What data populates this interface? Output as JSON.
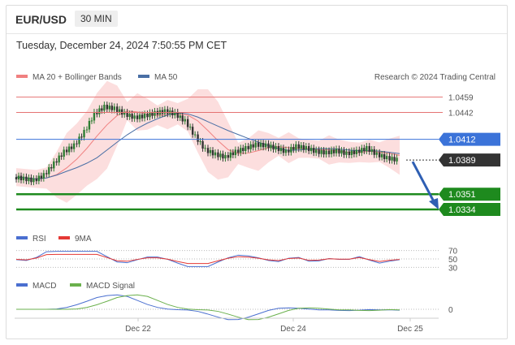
{
  "header": {
    "symbol": "EUR/USD",
    "timeframe": "30 MIN",
    "timestamp": "Tuesday, December 24, 2024 7:50:55 PM CET"
  },
  "chart_data": [
    {
      "type": "candlestick",
      "panel": "price",
      "legend": [
        {
          "name": "MA 20 + Bollinger Bands",
          "color": "#f08080"
        },
        {
          "name": "MA 50",
          "color": "#4a6fa5"
        }
      ],
      "attribution": "Research © 2024 Trading Central",
      "ylim": [
        1.0325,
        1.0465
      ],
      "x_ticks": [
        "Dec 22",
        "Dec 24",
        "Dec 25"
      ],
      "levels": [
        {
          "value": 1.0459,
          "label": "1.0459",
          "color": "#e57373",
          "style": "line-text"
        },
        {
          "value": 1.0442,
          "label": "1.0442",
          "color": "#e57373",
          "style": "line-text"
        },
        {
          "value": 1.0412,
          "label": "1.0412",
          "color": "#3b73d9",
          "style": "line-tag"
        },
        {
          "value": 1.0389,
          "label": "1.0389",
          "color": "#333333",
          "style": "dotted-tag"
        },
        {
          "value": 1.0351,
          "label": "1.0351",
          "color": "#1e8a1e",
          "style": "thick-tag"
        },
        {
          "value": 1.0334,
          "label": "1.0334",
          "color": "#1e8a1e",
          "style": "thick-tag"
        }
      ],
      "current_price": 1.0389,
      "forecast_arrow": {
        "from": 1.0389,
        "to": 1.0334
      },
      "approx_close_path": [
        1.037,
        1.0368,
        1.0366,
        1.0372,
        1.0385,
        1.0398,
        1.0405,
        1.042,
        1.044,
        1.0448,
        1.0446,
        1.044,
        1.0436,
        1.0438,
        1.0441,
        1.0443,
        1.044,
        1.0432,
        1.0415,
        1.04,
        1.0395,
        1.0392,
        1.0398,
        1.0402,
        1.0406,
        1.0405,
        1.0402,
        1.0398,
        1.0404,
        1.0402,
        1.0398,
        1.0397,
        1.0399,
        1.0396,
        1.0398,
        1.0402,
        1.0395,
        1.0391,
        1.0389
      ]
    },
    {
      "type": "line",
      "panel": "rsi",
      "legend": [
        {
          "name": "RSI",
          "color": "#4a6fd0"
        },
        {
          "name": "9MA",
          "color": "#e53935"
        }
      ],
      "y_ticks": [
        "70",
        "50",
        "30"
      ],
      "ylim": [
        25,
        75
      ]
    },
    {
      "type": "line",
      "panel": "macd",
      "legend": [
        {
          "name": "MACD",
          "color": "#4a6fd0"
        },
        {
          "name": "MACD Signal",
          "color": "#6ab04c"
        }
      ],
      "y_ticks": [
        "0"
      ]
    }
  ]
}
